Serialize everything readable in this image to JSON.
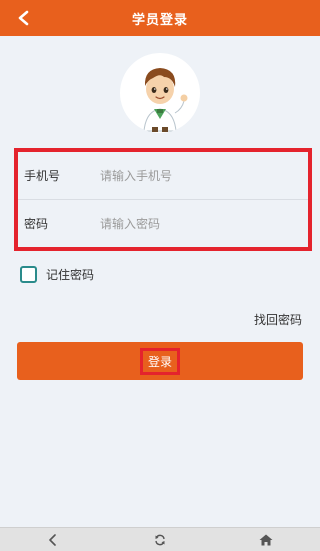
{
  "header": {
    "title": "学员登录",
    "back_icon": "chevron-left-icon"
  },
  "avatar": {
    "icon": "doctor-avatar"
  },
  "form": {
    "phone_label": "手机号",
    "phone_placeholder": "请输入手机号",
    "phone_value": "",
    "password_label": "密码",
    "password_placeholder": "请输入密码",
    "password_value": ""
  },
  "remember": {
    "label": "记住密码",
    "checked": false
  },
  "forgot_label": "找回密码",
  "login_label": "登录",
  "navbar": {
    "icons": [
      "back-icon",
      "refresh-icon",
      "home-icon"
    ]
  },
  "colors": {
    "accent": "#e8601d",
    "highlight": "#e4232d",
    "checkbox": "#2a8b8b",
    "background": "#eef2f7"
  }
}
